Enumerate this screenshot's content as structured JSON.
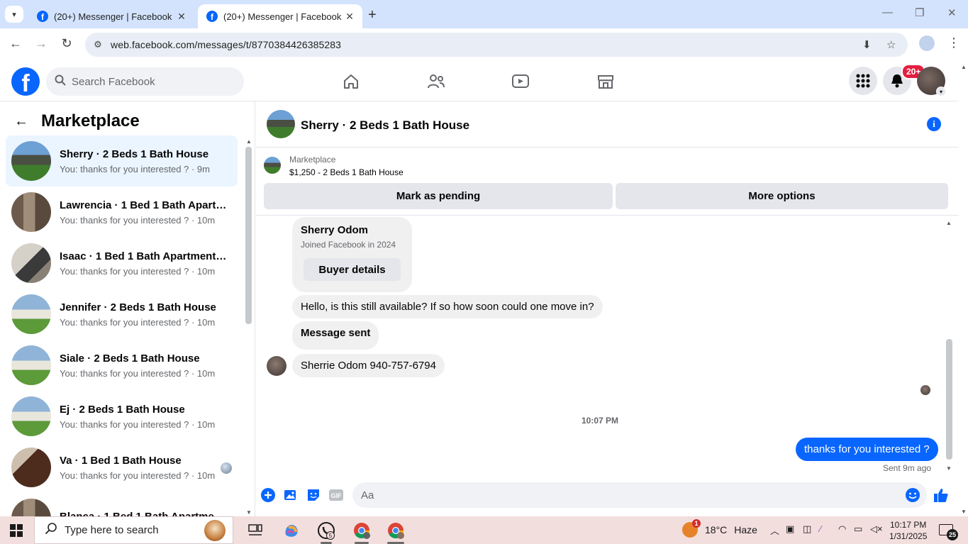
{
  "browser": {
    "tabs": [
      {
        "title": "(20+) Messenger | Facebook",
        "active": false
      },
      {
        "title": "(20+) Messenger | Facebook",
        "active": true
      }
    ],
    "url": "web.facebook.com/messages/t/8770384426385283"
  },
  "header": {
    "search_placeholder": "Search Facebook",
    "notification_badge": "20+"
  },
  "left_panel": {
    "title": "Marketplace",
    "conversations": [
      {
        "name": "Sherry · 2 Beds 1 Bath House",
        "preview": "You: thanks for you interested ? · 9m",
        "thumb": "house2",
        "active": true
      },
      {
        "name": "Lawrencia · 1 Bed 1 Bath Apartm...",
        "preview": "You: thanks for you interested ? · 10m",
        "thumb": "apt",
        "active": false
      },
      {
        "name": "Isaac · 1 Bed 1 Bath Apartment/c...",
        "preview": "You: thanks for you interested ? · 10m",
        "thumb": "room",
        "active": false
      },
      {
        "name": "Jennifer · 2 Beds 1 Bath House",
        "preview": "You: thanks for you interested ? · 10m",
        "thumb": "house",
        "active": false
      },
      {
        "name": "Siale · 2 Beds 1 Bath House",
        "preview": "You: thanks for you interested ? · 10m",
        "thumb": "house",
        "active": false
      },
      {
        "name": "Ej · 2 Beds 1 Bath House",
        "preview": "You: thanks for you interested ? · 10m",
        "thumb": "house",
        "active": false
      },
      {
        "name": "Va · 1 Bed 1 Bath House",
        "preview": "You: thanks for you interested ? · 10m",
        "thumb": "dark",
        "active": false
      },
      {
        "name": "Blanca · 1 Bed 1 Bath Apartment...",
        "preview": "",
        "thumb": "apt",
        "active": false
      }
    ]
  },
  "chat": {
    "title": "Sherry · 2 Beds 1 Bath House",
    "listing_label": "Marketplace",
    "listing_price": "$1,250 - 2 Beds 1 Bath House",
    "mark_pending": "Mark as pending",
    "more_options": "More options",
    "buyer_name": "Sherry Odom",
    "buyer_joined": "Joined Facebook in 2024",
    "buyer_details": "Buyer details",
    "messages": [
      "Hello, is this still available? If so how soon could one move in?",
      "Message sent",
      "Sherrie Odom 940-757-6794"
    ],
    "timestamp": "10:07 PM",
    "outgoing": "thanks for you interested ?",
    "sent_status": "Sent 9m ago",
    "composer_placeholder": "Aa"
  },
  "taskbar": {
    "search_label": "Type here to search",
    "weather_temp": "18°C",
    "weather_desc": "Haze",
    "weather_badge": "1",
    "time": "10:17 PM",
    "date": "1/31/2025",
    "notif_count": "25",
    "whatsapp_badge": "5"
  },
  "colors": {
    "facebook_blue": "#0866ff",
    "active_conv_bg": "#ebf5ff",
    "badge_red": "#e41e3f",
    "taskbar_bg": "#f3dede"
  }
}
